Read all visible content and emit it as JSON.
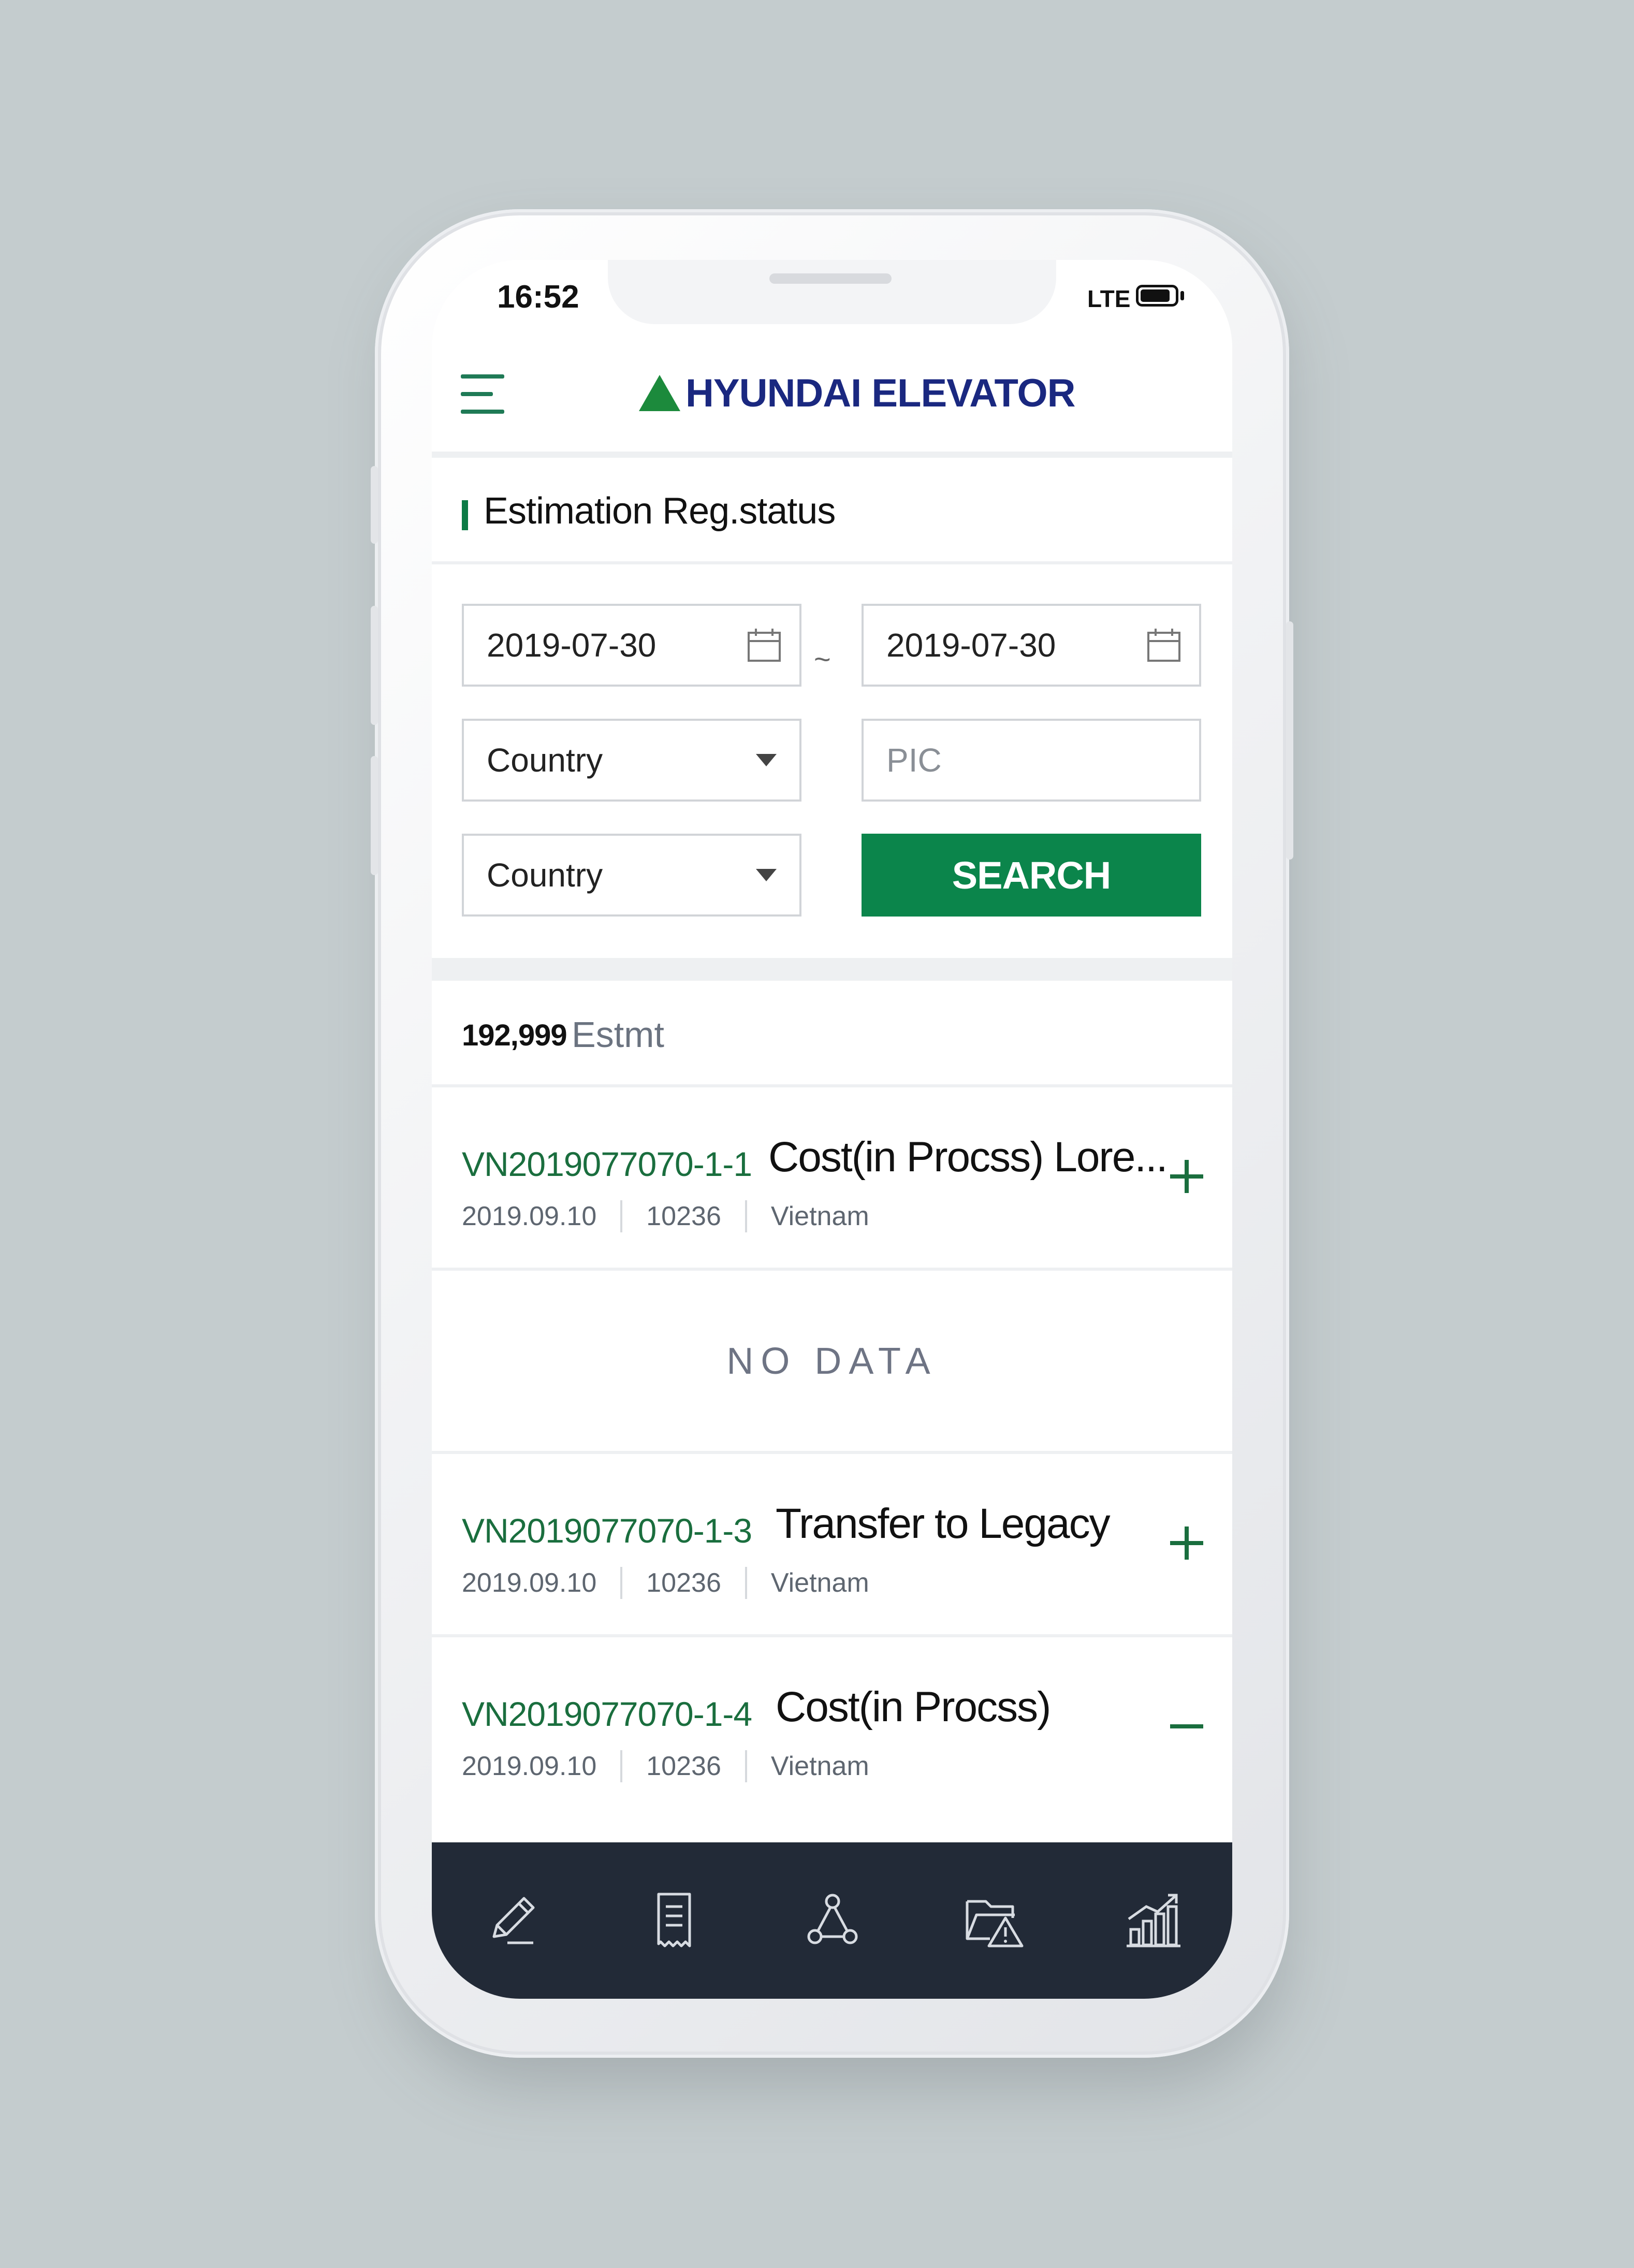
{
  "status_bar": {
    "time": "16:52",
    "network": "LTE"
  },
  "header": {
    "brand": "HYUNDAI ELEVATOR"
  },
  "page": {
    "title": "Estimation Reg.status"
  },
  "filters": {
    "date_from": "2019-07-30",
    "date_separator": "~",
    "date_to": "2019-07-30",
    "country_select_1": "Country",
    "pic_placeholder": "PIC",
    "country_select_2": "Country",
    "search_label": "SEARCH"
  },
  "results": {
    "count": "192,999",
    "unit": "Estmt",
    "no_data_label": "NO DATA",
    "items": [
      {
        "id": "VN2019077070-1-1",
        "status": "Cost(in Procss) Lore...",
        "date": "2019.09.10",
        "code": "10236",
        "country": "Vietnam",
        "toggle": "expand"
      },
      {
        "id": "VN2019077070-1-3",
        "status": "Transfer to Legacy",
        "date": "2019.09.10",
        "code": "10236",
        "country": "Vietnam",
        "toggle": "expand"
      },
      {
        "id": "VN2019077070-1-4",
        "status": "Cost(in Procss)",
        "date": "2019.09.10",
        "code": "10236",
        "country": "Vietnam",
        "toggle": "collapse"
      }
    ]
  },
  "colors": {
    "accent_green": "#0b854b",
    "brand_blue": "#1a2880",
    "tabbar": "#222a37"
  },
  "tabbar": {
    "tabs": [
      {
        "icon": "pencil-icon"
      },
      {
        "icon": "receipt-icon"
      },
      {
        "icon": "network-icon"
      },
      {
        "icon": "folder-warning-icon"
      },
      {
        "icon": "chart-growth-icon"
      }
    ]
  }
}
